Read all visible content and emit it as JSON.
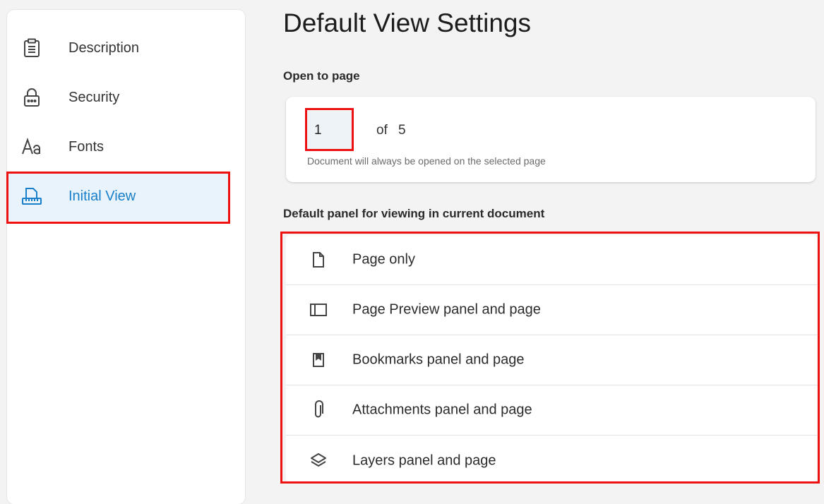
{
  "sidebar": {
    "items": [
      {
        "label": "Description",
        "icon": "clipboard-icon"
      },
      {
        "label": "Security",
        "icon": "lock-icon"
      },
      {
        "label": "Fonts",
        "icon": "font-icon"
      },
      {
        "label": "Initial View",
        "icon": "ruler-page-icon",
        "active": true
      }
    ]
  },
  "main": {
    "title": "Default View Settings",
    "open_to_page": {
      "label": "Open to page",
      "value": "1",
      "of_label": "of",
      "total": "5",
      "hint": "Document will always be opened on the selected page"
    },
    "default_panel": {
      "label": "Default panel for viewing in current document",
      "options": [
        {
          "label": "Page only",
          "icon": "page-icon"
        },
        {
          "label": "Page Preview panel and page",
          "icon": "panel-icon"
        },
        {
          "label": "Bookmarks panel and page",
          "icon": "bookmark-icon"
        },
        {
          "label": "Attachments panel and page",
          "icon": "paperclip-icon"
        },
        {
          "label": "Layers panel and page",
          "icon": "layers-icon"
        }
      ]
    }
  },
  "colors": {
    "accent": "#1a7fc9",
    "active_bg": "#e8f3fc",
    "highlight": "#ee1111"
  }
}
